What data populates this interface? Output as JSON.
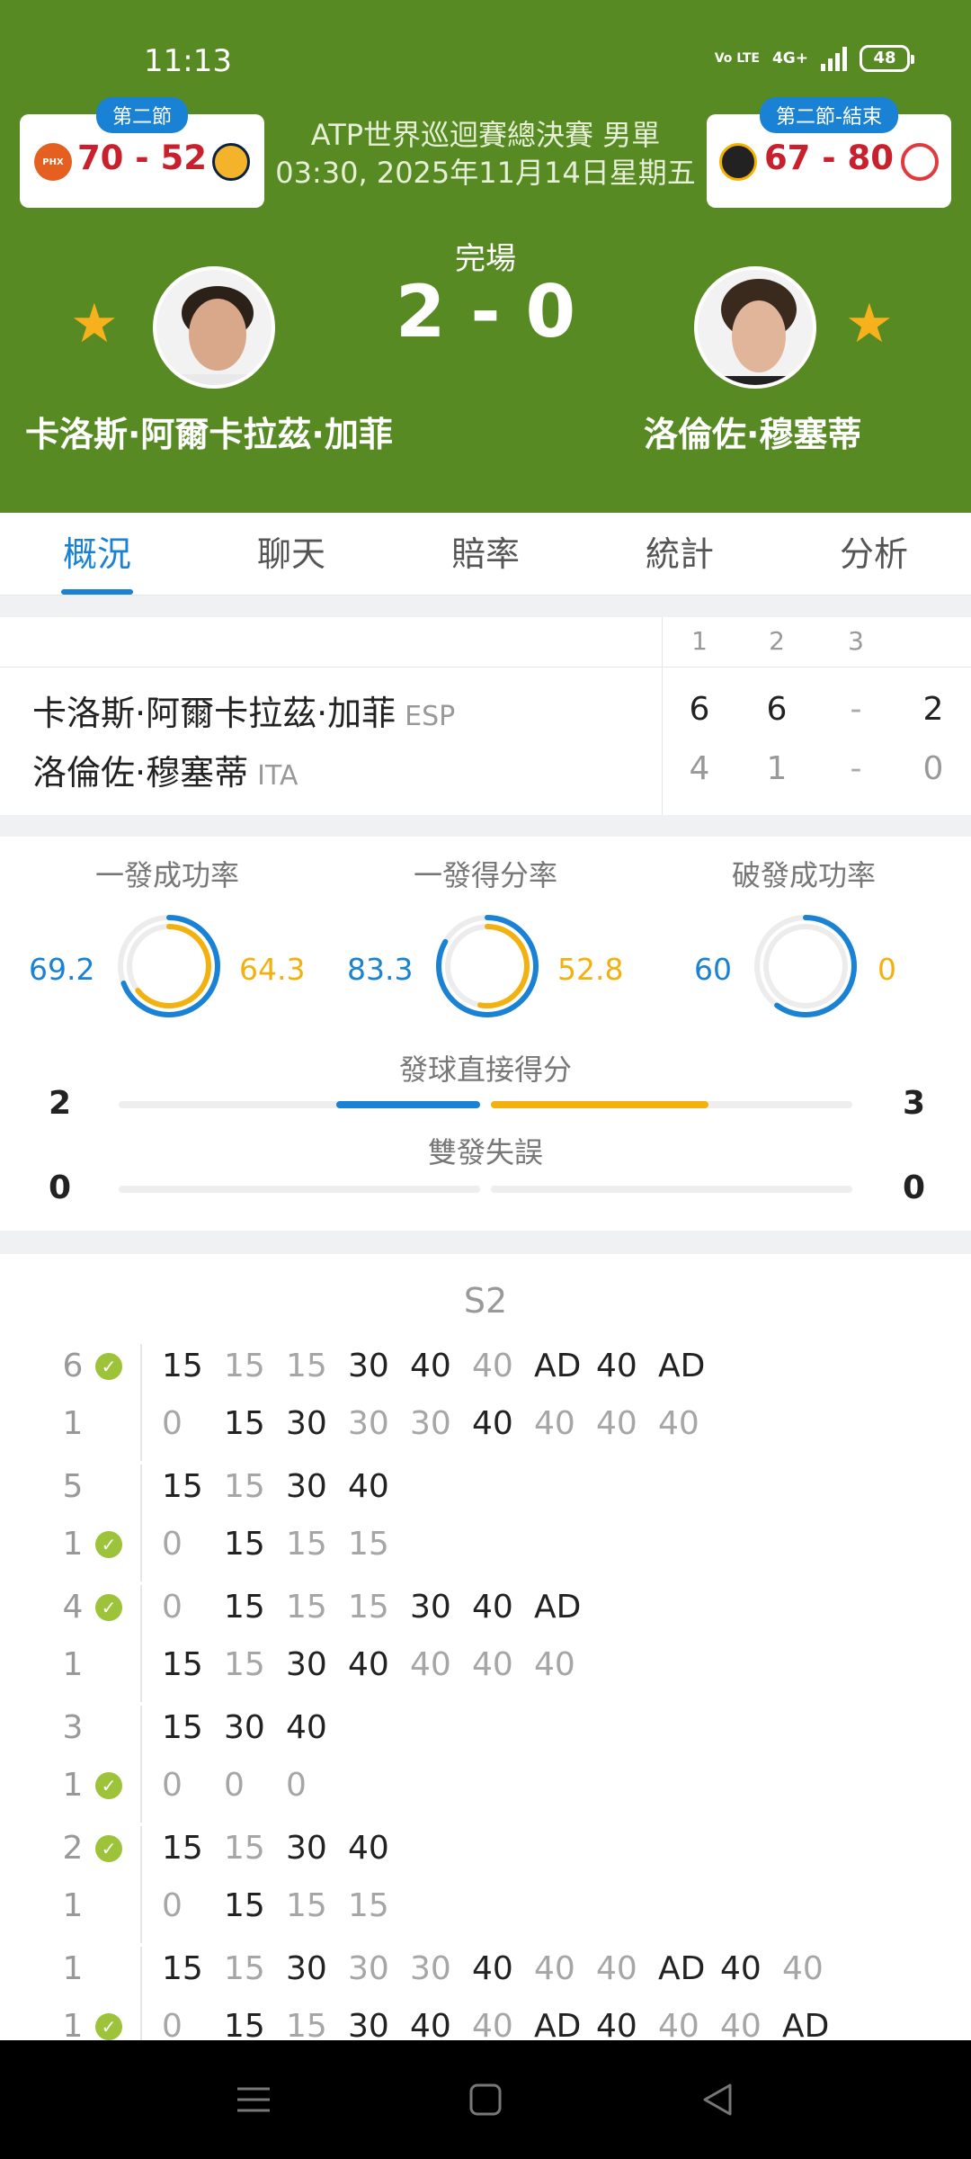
{
  "status_bar": {
    "time": "11:13",
    "volte": "Vo LTE",
    "network": "4G+",
    "battery": "48"
  },
  "left_game": {
    "badge": "第二節",
    "score": "70 - 52",
    "home_logo": "PHX",
    "away_logo": "IND"
  },
  "right_game": {
    "badge": "第二節-結束",
    "score": "67 - 80",
    "home_logo": "UTA",
    "away_logo": "ATL"
  },
  "event": {
    "title": "ATP世界巡迴賽總決賽 男單",
    "datetime": "03:30, 2025年11月14日星期五"
  },
  "match": {
    "status": "完場",
    "score": "2 - 0",
    "player1": "卡洛斯·阿爾卡拉茲·加菲",
    "player2": "洛倫佐·穆塞蒂"
  },
  "tabs": [
    "概況",
    "聊天",
    "賠率",
    "統計",
    "分析"
  ],
  "scoreboard": {
    "headers": [
      "1",
      "2",
      "3"
    ],
    "rows": [
      {
        "name": "卡洛斯·阿爾卡拉茲·加菲",
        "country": "ESP",
        "s1": "6",
        "s2": "6",
        "s3": "-",
        "total": "2"
      },
      {
        "name": "洛倫佐·穆塞蒂",
        "country": "ITA",
        "s1": "4",
        "s2": "1",
        "s3": "-",
        "total": "0"
      }
    ]
  },
  "stats": {
    "rings": [
      {
        "title": "一發成功率",
        "left": "69.2",
        "right": "64.3",
        "left_pct": 69.2,
        "right_pct": 64.3
      },
      {
        "title": "一發得分率",
        "left": "83.3",
        "right": "52.8",
        "left_pct": 83.3,
        "right_pct": 52.8
      },
      {
        "title": "破發成功率",
        "left": "60",
        "right": "0",
        "left_pct": 60,
        "right_pct": 0
      }
    ],
    "aces": {
      "label": "發球直接得分",
      "left": "2",
      "right": "3"
    },
    "double_faults": {
      "label": "雙發失誤",
      "left": "0",
      "right": "0"
    }
  },
  "point_by_point": {
    "set_label": "S2",
    "games": [
      {
        "top_score": "6",
        "bot_score": "1",
        "server": "top",
        "top": [
          "15",
          "15",
          "15",
          "30",
          "40",
          "40",
          "AD",
          "40",
          "AD"
        ],
        "bot": [
          "0",
          "15",
          "30",
          "30",
          "30",
          "40",
          "40",
          "40",
          "40"
        ]
      },
      {
        "top_score": "5",
        "bot_score": "1",
        "server": "bot",
        "top": [
          "15",
          "15",
          "30",
          "40"
        ],
        "bot": [
          "0",
          "15",
          "15",
          "15"
        ]
      },
      {
        "top_score": "4",
        "bot_score": "1",
        "server": "top",
        "top": [
          "0",
          "15",
          "15",
          "15",
          "30",
          "40",
          "AD"
        ],
        "bot": [
          "15",
          "15",
          "30",
          "40",
          "40",
          "40",
          "40"
        ]
      },
      {
        "top_score": "3",
        "bot_score": "1",
        "server": "bot",
        "top": [
          "15",
          "30",
          "40"
        ],
        "bot": [
          "0",
          "0",
          "0"
        ]
      },
      {
        "top_score": "2",
        "bot_score": "1",
        "server": "top",
        "top": [
          "15",
          "15",
          "30",
          "40"
        ],
        "bot": [
          "0",
          "15",
          "15",
          "15"
        ]
      },
      {
        "top_score": "1",
        "bot_score": "1",
        "server": "bot",
        "top": [
          "15",
          "15",
          "30",
          "30",
          "30",
          "40",
          "40",
          "40",
          "AD",
          "40",
          "40"
        ],
        "bot": [
          "0",
          "15",
          "15",
          "30",
          "40",
          "40",
          "AD",
          "40",
          "40",
          "40",
          "AD"
        ]
      }
    ]
  },
  "colors": {
    "header_green": "#588a24",
    "accent_blue": "#1a82d4",
    "accent_orange": "#f2b10f",
    "score_red": "#c8202c"
  }
}
